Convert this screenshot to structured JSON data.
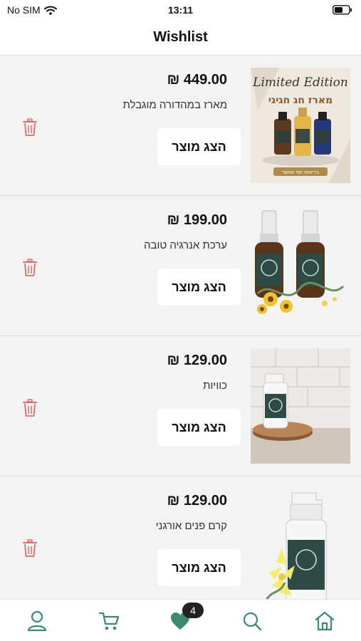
{
  "status_bar": {
    "carrier": "No SIM",
    "time": "13:11"
  },
  "header": {
    "title": "Wishlist"
  },
  "colors": {
    "accent": "#3a8a72",
    "trash": "#e06b6b",
    "list_background": "#f3f3f3"
  },
  "wishlist": {
    "button_label": "הצג מוצר",
    "items": [
      {
        "price": "₪ 449.00",
        "name": "מארז במהדורה מוגבלת",
        "image_text_1": "Limited Edition",
        "image_text_2": "מארז חג חגיגי",
        "image_text_3": "בריאות יופי ואושר"
      },
      {
        "price": "₪ 199.00",
        "name": "ערכת אנרגיה טובה"
      },
      {
        "price": "₪ 129.00",
        "name": "כוויות"
      },
      {
        "price": "₪ 129.00",
        "name": "קרם פנים אורגני"
      }
    ]
  },
  "tab_bar": {
    "wishlist_count": "4",
    "tabs": [
      "user-icon",
      "cart-icon",
      "heart-icon",
      "search-icon",
      "home-icon"
    ]
  }
}
